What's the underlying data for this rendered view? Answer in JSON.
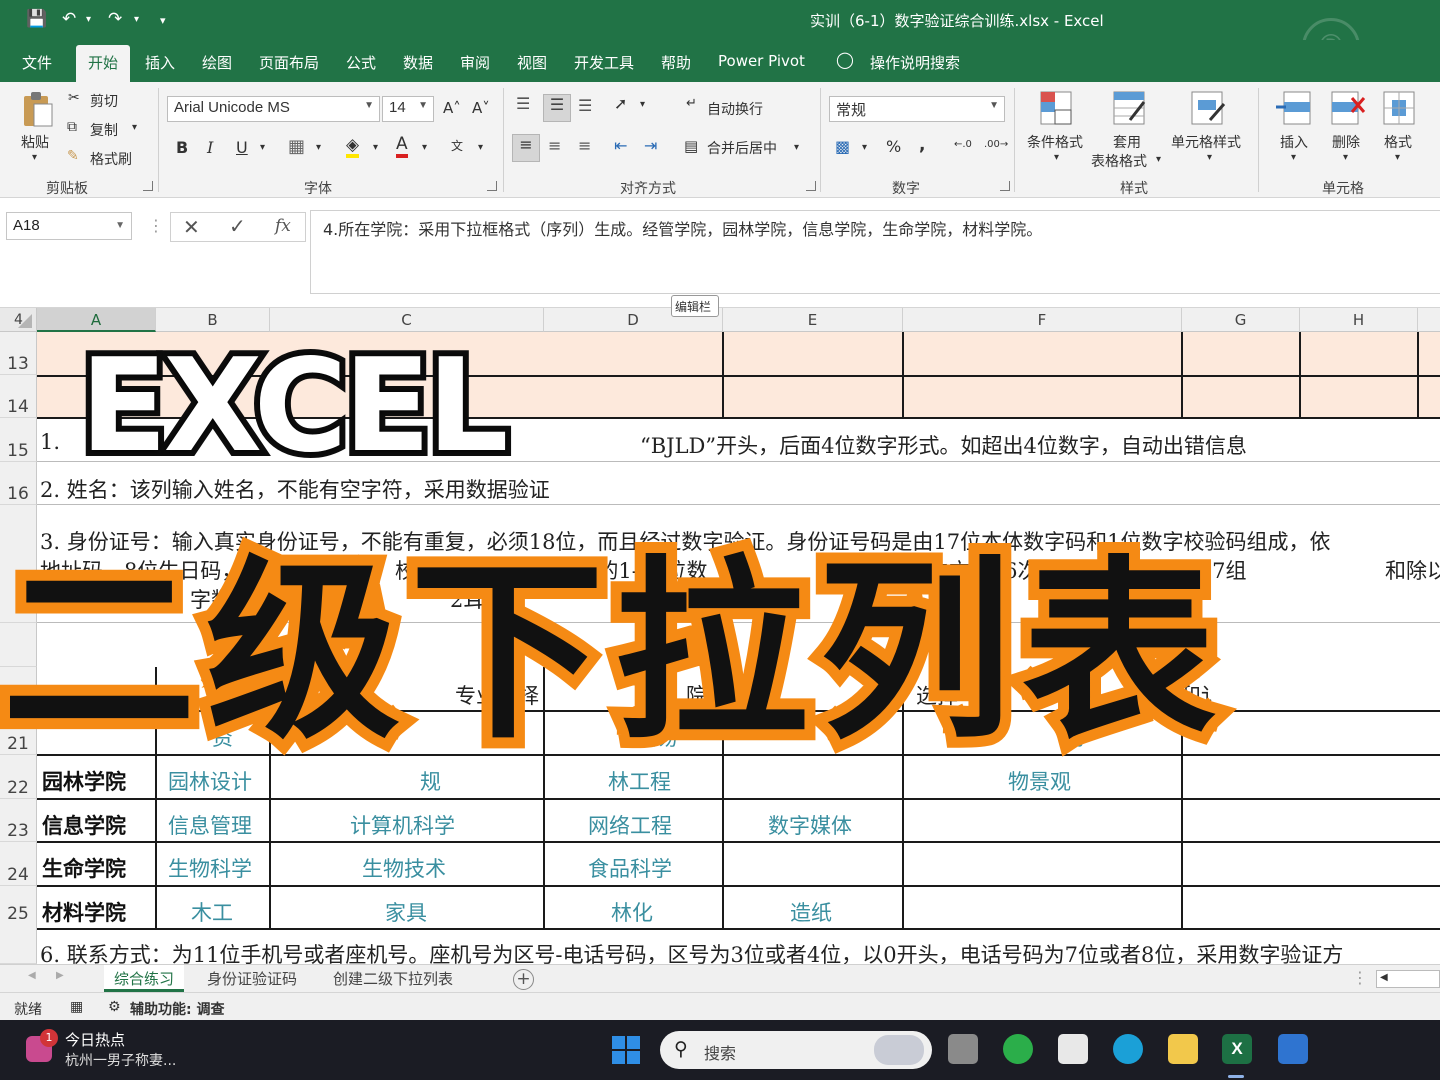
{
  "window": {
    "title": "实训（6-1）数字验证综合训练.xlsx  -  Excel"
  },
  "tabs": [
    "文件",
    "开始",
    "插入",
    "绘图",
    "页面布局",
    "公式",
    "数据",
    "审阅",
    "视图",
    "开发工具",
    "帮助",
    "Power Pivot",
    "操作说明搜索"
  ],
  "ribbon": {
    "clipboard": {
      "paste": "粘贴",
      "cut": "剪切",
      "copy": "复制",
      "format_painter": "格式刷",
      "label": "剪贴板"
    },
    "font": {
      "name": "Arial Unicode MS",
      "size": "14",
      "label": "字体"
    },
    "alignment": {
      "wrap": "自动换行",
      "merge": "合并后居中",
      "label": "对齐方式"
    },
    "number": {
      "format": "常规",
      "label": "数字"
    },
    "styles": {
      "conditional": "条件格式",
      "table_1": "套用",
      "table_2": "表格格式",
      "cell_style": "单元格样式",
      "label": "样式"
    },
    "cells": {
      "insert": "插入",
      "delete": "删除",
      "format": "格式",
      "label": "单元格"
    }
  },
  "formula_bar": {
    "name_box": "A18",
    "fx": "fx",
    "content": "4.所在学院：采用下拉框格式（序列）生成。经管学院，园林学院，信息学院，生命学院，材料学院。",
    "label": "编辑栏"
  },
  "sheet": {
    "columns": [
      "A",
      "B",
      "C",
      "D",
      "E",
      "F",
      "G",
      "H"
    ],
    "rows": [
      "13",
      "14",
      "15",
      "16",
      "",
      "",
      "",
      "21",
      "22",
      "23",
      "24",
      "25"
    ],
    "row_4_header": "4",
    "text_lines": {
      "line15": "1.",
      "line15_tail": "“BJLD”开头，后面4位数字形式。如超出4位数字，自动出错信息",
      "line16": "2. 姓名：该列输入姓名，不能有空字符，采用数据验证",
      "line17a": "3. 身份证号：输入真实身份证号，不能有重复，必须18位，而且经过数字验证。身份证号码是由17位本体数字码和1位数字校验码组成，依",
      "line17b": "地址码，8位生日码，3",
      "line17b_mid": "校验码。1）身份证号的1-17位数",
      "line17b_mid2": "次乘",
      "line17b_mid3": "的17次方，16次方……2）将以上17组",
      "line17b_end": "和除以",
      "line17c": "字数n",
      "line17c_mid": "2耳",
      "line17c_end": "码",
      "line19_mid1": "专业选择",
      "line19_mid2": "院",
      "line19_mid3": "选择",
      "line19_mid4": "和讠",
      "line20_a": "资",
      "line20_d": "贸易",
      "line20_f": "务",
      "line25": "6. 联系方式：为11位手机号或者座机号。座机号为区号-电话号码，区号为3位或者4位，以0开头，电话号码为7位或者8位，采用数字验证方"
    },
    "colleges": [
      {
        "name": "园林学院",
        "majors": [
          "园林设计",
          "规",
          "林工程",
          "",
          "物景观"
        ]
      },
      {
        "name": "信息学院",
        "majors": [
          "信息管理",
          "计算机科学",
          "网络工程",
          "数字媒体",
          ""
        ]
      },
      {
        "name": "生命学院",
        "majors": [
          "生物科学",
          "生物技术",
          "食品科学",
          "",
          ""
        ]
      },
      {
        "name": "材料学院",
        "majors": [
          "木工",
          "家具",
          "林化",
          "造纸",
          ""
        ]
      }
    ]
  },
  "overlay": {
    "headline": "EXCEL",
    "subtitle": "二级下拉列表"
  },
  "sheet_tabs": [
    "综合练习",
    "身份证验证码",
    "创建二级下拉列表"
  ],
  "status": {
    "ready": "就绪",
    "accessibility": "辅助功能: 调查"
  },
  "taskbar": {
    "news_badge": "1",
    "news_title": "今日热点",
    "news_sub": "杭州一男子称妻...",
    "search": "搜索"
  },
  "colors": {
    "excel_green": "#217346",
    "overlay_orange": "#f58a14",
    "major_teal": "#3a8fa0",
    "header_fill": "#fde9dc"
  }
}
